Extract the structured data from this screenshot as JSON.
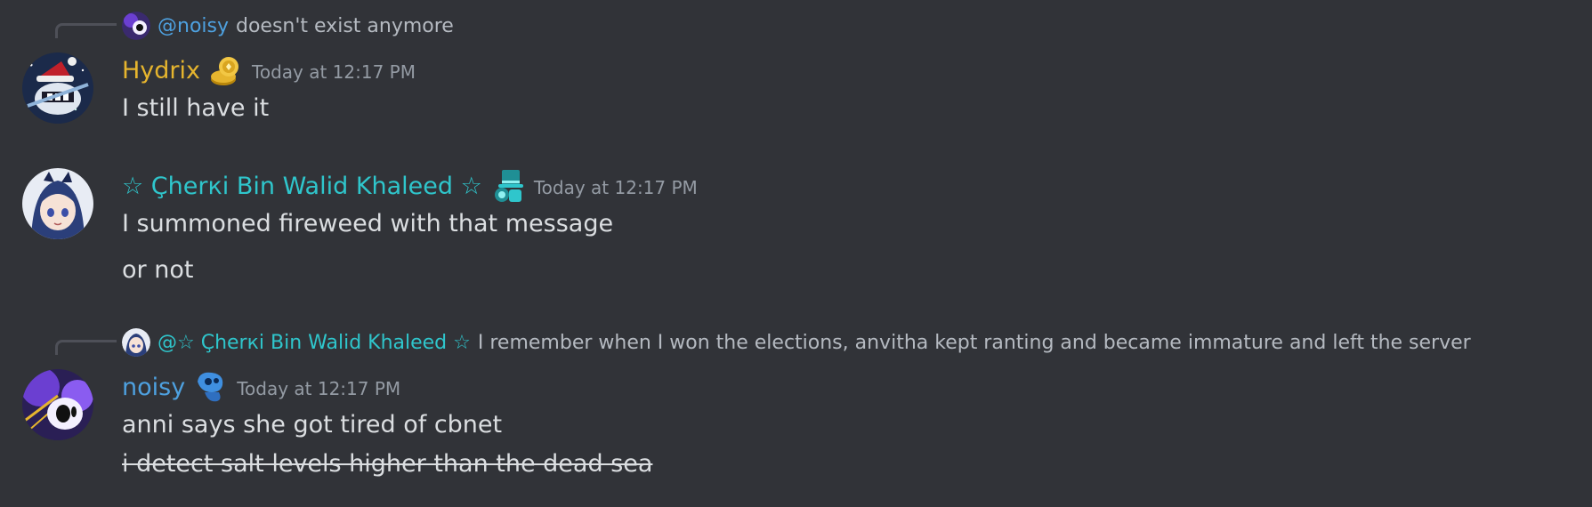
{
  "colors": {
    "background": "#313338",
    "text": "#dbdee1",
    "muted": "#949ba4",
    "noisy": "#4ea1e0",
    "hydrix": "#e6b52e",
    "cherki": "#2fc6cc"
  },
  "messages": [
    {
      "reply": {
        "user": "@noisy",
        "text": "doesn't exist anymore"
      },
      "author": "Hydrix",
      "author_icon": "gold-coin-badge-icon",
      "timestamp": "Today at 12:17 PM",
      "lines": [
        "I still have it"
      ]
    },
    {
      "author": "☆ Çherкi Bin Walid Khaleed ☆",
      "author_icon": "top-hat-badge-icon",
      "timestamp": "Today at 12:17 PM",
      "lines": [
        "I summoned fireweed with that message",
        "or not"
      ]
    },
    {
      "reply": {
        "user": "@☆ Çherкi Bin Walid Khaleed ☆",
        "text": "I remember when I won the elections, anvitha kept ranting and became immature and left the server"
      },
      "author": "noisy",
      "author_icon": "blue-creature-badge-icon",
      "timestamp": "Today at 12:17 PM",
      "lines": [
        "anni says she got tired of cbnet",
        "i detect salt levels higher than the dead sea"
      ]
    }
  ]
}
